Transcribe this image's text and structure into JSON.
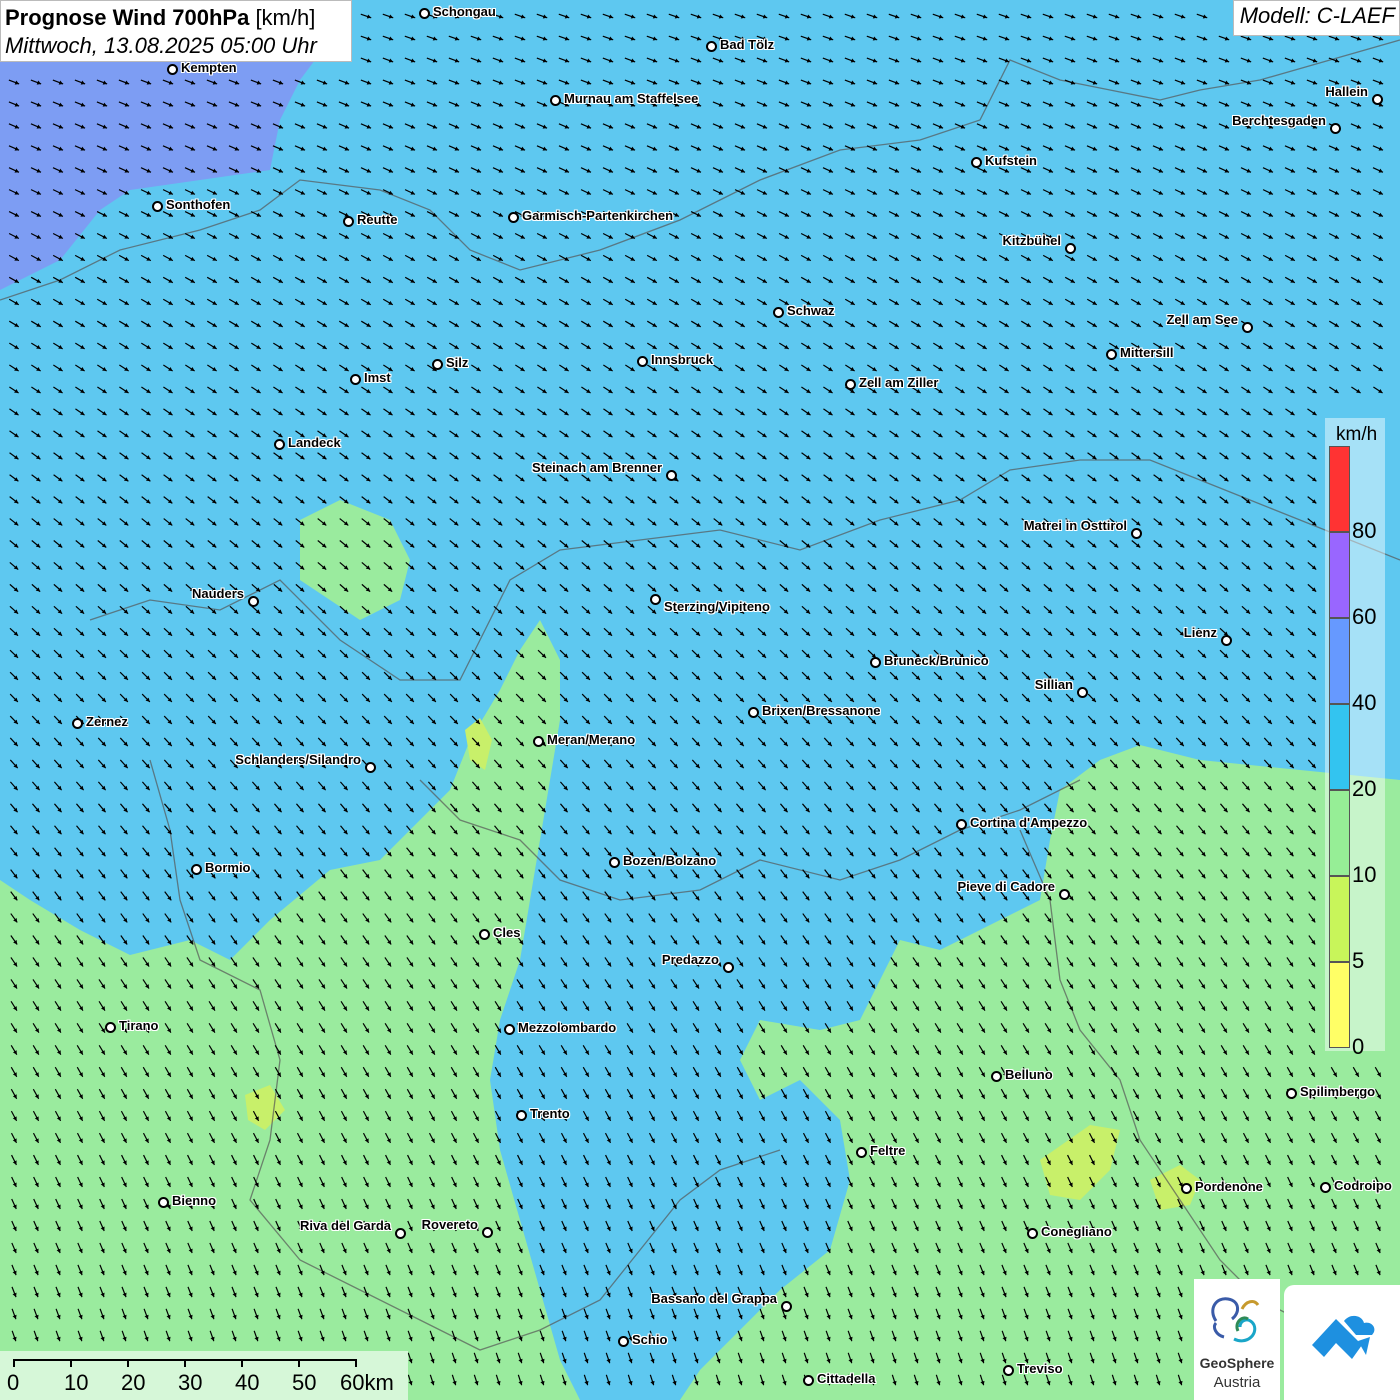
{
  "title": {
    "main_bold": "Prognose Wind 700hPa",
    "main_unit": "[km/h]",
    "subtitle": "Mittwoch, 13.08.2025 05:00 Uhr"
  },
  "model": "Modell: C-LAEF",
  "legend": {
    "unit": "km/h",
    "colors": [
      "#ffff66",
      "#c8f55a",
      "#96ee96",
      "#33c4f0",
      "#6699ff",
      "#9966ff",
      "#ff3333"
    ],
    "ticks": [
      "0",
      "5",
      "10",
      "20",
      "40",
      "60",
      "80"
    ]
  },
  "wind": {
    "dominant_direction": "north-west",
    "arrow_color": "#000000"
  },
  "cities": [
    {
      "name": "Schongau"
    },
    {
      "name": "Bad Tölz"
    },
    {
      "name": "Kempten"
    },
    {
      "name": "Murnau am Staffelsee"
    },
    {
      "name": "Hallein"
    },
    {
      "name": "Berchtesgaden"
    },
    {
      "name": "Kufstein"
    },
    {
      "name": "Sonthofen"
    },
    {
      "name": "Reutte"
    },
    {
      "name": "Garmisch-Partenkirchen"
    },
    {
      "name": "Kitzbühel"
    },
    {
      "name": "Schwaz"
    },
    {
      "name": "Zell am See"
    },
    {
      "name": "Mittersill"
    },
    {
      "name": "Silz"
    },
    {
      "name": "Innsbruck"
    },
    {
      "name": "Imst"
    },
    {
      "name": "Zell am Ziller"
    },
    {
      "name": "Landeck"
    },
    {
      "name": "Steinach am Brenner"
    },
    {
      "name": "Matrei in Osttirol"
    },
    {
      "name": "Nauders"
    },
    {
      "name": "Sterzing/Vipiteno"
    },
    {
      "name": "Lienz"
    },
    {
      "name": "Bruneck/Brunico"
    },
    {
      "name": "Sillian"
    },
    {
      "name": "Zernez"
    },
    {
      "name": "Brixen/Bressanone"
    },
    {
      "name": "Meran/Merano"
    },
    {
      "name": "Schlanders/Silandro"
    },
    {
      "name": "Cortina d'Ampezzo"
    },
    {
      "name": "Bozen/Bolzano"
    },
    {
      "name": "Bormio"
    },
    {
      "name": "Pieve di Cadore"
    },
    {
      "name": "Cles"
    },
    {
      "name": "Predazzo"
    },
    {
      "name": "Tirano"
    },
    {
      "name": "Mezzolombardo"
    },
    {
      "name": "Belluno"
    },
    {
      "name": "Spilimbergo"
    },
    {
      "name": "Trento"
    },
    {
      "name": "Feltre"
    },
    {
      "name": "Pordenone"
    },
    {
      "name": "Codroipo"
    },
    {
      "name": "Bienno"
    },
    {
      "name": "Riva del Garda"
    },
    {
      "name": "Rovereto"
    },
    {
      "name": "Conegliano"
    },
    {
      "name": "Bassano del Grappa"
    },
    {
      "name": "Schio"
    },
    {
      "name": "Treviso"
    },
    {
      "name": "Cittadella"
    }
  ],
  "scale_bar": {
    "labels": [
      "0",
      "10",
      "20",
      "30",
      "40",
      "50",
      "60km"
    ]
  },
  "logos": {
    "geosphere_line1": "GeoSphere",
    "geosphere_line2": "Austria"
  }
}
